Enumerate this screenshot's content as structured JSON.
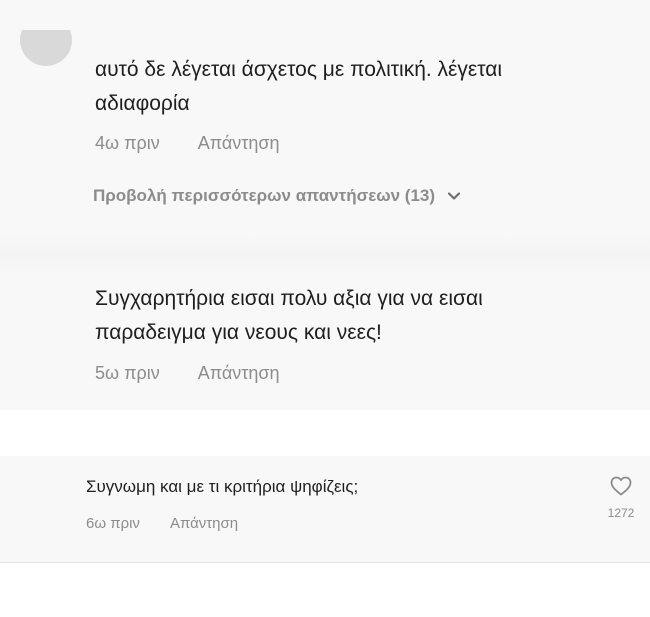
{
  "comments": [
    {
      "text_line1": "αυτό δε λέγεται άσχετος με πολιτική. λέγεται",
      "text_line2": "αδιαφορία",
      "time": "4ω πριν",
      "reply_label": "Απάντηση",
      "view_replies_label": "Προβολή περισσότερων απαντήσεων (13)"
    },
    {
      "text_line1": "Συγχαρητήρια εισαι πολυ αξια για να εισαι",
      "text_line2": "παραδειγμα για νεους και νεες!",
      "time": "5ω πριν",
      "reply_label": "Απάντηση"
    },
    {
      "text": "Συγνωμη και με τι κριτήρια ψηφίζεις;",
      "time": "6ω πριν",
      "reply_label": "Απάντηση",
      "like_count": "1272"
    }
  ],
  "icons": {
    "avatar": "avatar",
    "chevron": "chevron-down-icon",
    "like": "heart-outline-icon"
  },
  "colors": {
    "panel_background": "#f8f8f8",
    "text_primary": "#1f1f1f",
    "text_secondary": "#8c8c8c"
  }
}
